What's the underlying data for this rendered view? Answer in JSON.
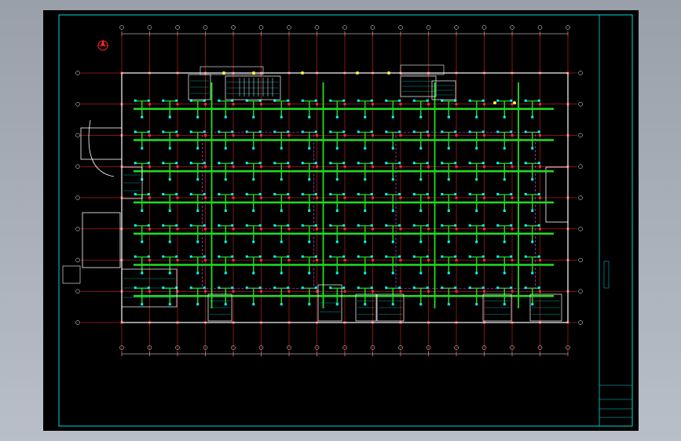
{
  "drawing": {
    "title": "",
    "scale": "",
    "grid_cols": 17,
    "grid_rows": 9,
    "colors": {
      "background": "#000000",
      "frame": "#00d8d8",
      "grid": "#ff2a2a",
      "duct": "#22dd22",
      "diffuser": "#00ffff",
      "wall": "#ffffff",
      "magenta": "#ff44ff",
      "yellow": "#ffff33"
    },
    "north_arrow": "north-arrow-icon"
  },
  "title_block": {
    "items": [
      "",
      "",
      "",
      "",
      ""
    ]
  }
}
